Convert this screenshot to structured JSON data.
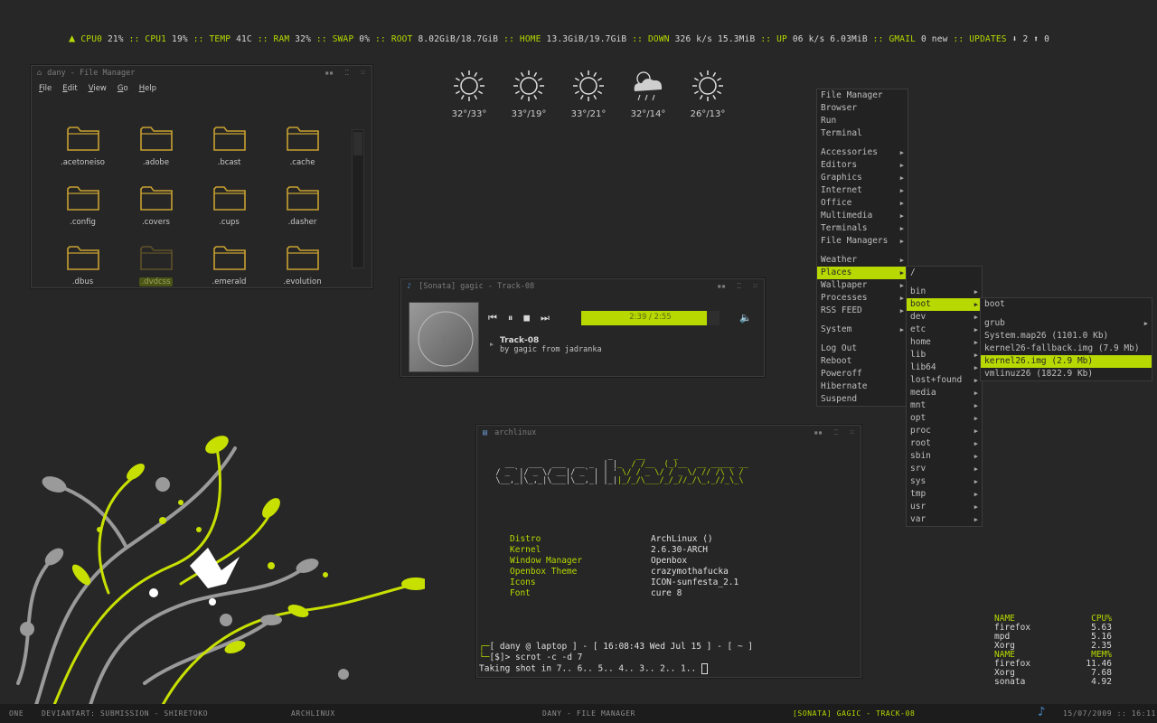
{
  "conky_bar": {
    "logo_icon": "arch-triangle-icon",
    "items": [
      {
        "label": "CPU0",
        "value": "21%"
      },
      {
        "label": "CPU1",
        "value": "19%"
      },
      {
        "label": "TEMP",
        "value": "41C"
      },
      {
        "label": "RAM",
        "value": "32%"
      },
      {
        "label": "SWAP",
        "value": "0%"
      },
      {
        "label": "ROOT",
        "value": "8.02GiB/18.7GiB"
      },
      {
        "label": "HOME",
        "value": "13.3GiB/19.7GiB"
      },
      {
        "label": "DOWN",
        "value": "326  k/s 15.3MiB"
      },
      {
        "label": "UP",
        "value": "06  k/s 6.03MiB"
      },
      {
        "label": "GMAIL",
        "value": "0 new"
      },
      {
        "label": "UPDATES",
        "value": "2",
        "extra": "0"
      }
    ],
    "separator": "::"
  },
  "file_manager": {
    "title": "dany - File Manager",
    "menus": [
      "File",
      "Edit",
      "View",
      "Go",
      "Help"
    ],
    "folders": [
      ".acetoneiso",
      ".adobe",
      ".bcast",
      ".cache",
      ".config",
      ".covers",
      ".cups",
      ".dasher",
      ".dbus",
      ".dvdcss",
      ".emerald",
      ".evolution"
    ],
    "selected_index": 9
  },
  "weather": [
    {
      "icon": "sun-icon",
      "temp": "32°/33°"
    },
    {
      "icon": "sun-icon",
      "temp": "33°/19°"
    },
    {
      "icon": "sun-icon",
      "temp": "33°/21°"
    },
    {
      "icon": "rain-cloud-icon",
      "temp": "32°/14°"
    },
    {
      "icon": "sun-icon",
      "temp": "26°/13°"
    }
  ],
  "sonata": {
    "title": "[Sonata] gagic - Track-08",
    "progress_text": "2:39 / 2:55",
    "progress_fraction": 0.91,
    "track": "Track-08",
    "artist_line": "by gagic from jadranka"
  },
  "terminal": {
    "title": "archlinux",
    "ascii_art": [
      "                          _     __      _",
      "    __   ___  ___  __ _  | |_  / /__  (_)__  __ _____ __",
      "  / _ `|/ _ \\/ __|/ _` | | ' \\/ / _ \\/ / _ \\/ // /\\ \\ /",
      "  \\__,_|\\_,_|\\___|\\__,_| |_||_/_/\\___/_/_//_/\\_,_//_\\_\\"
    ],
    "ascii_green_split": 28,
    "info": [
      {
        "key": "Distro",
        "value": "ArchLinux  ()"
      },
      {
        "key": "Kernel",
        "value": "2.6.30-ARCH"
      },
      {
        "key": "Window Manager",
        "value": "Openbox"
      },
      {
        "key": "Openbox Theme",
        "value": "crazymothafucka"
      },
      {
        "key": "Icons",
        "value": "ICON-sunfesta_2.1"
      },
      {
        "key": "Font",
        "value": "cure 8"
      }
    ],
    "prompt_line1": "[ dany @ laptop ] - [ 16:08:43 Wed Jul 15 ] - [ ~ ]",
    "prompt_line2": "[$]> scrot -c -d 7",
    "output_line": "Taking shot in 7.. 6.. 5.. 4.. 3.. 2.. 1.. "
  },
  "menu_root": {
    "groups": [
      [
        {
          "label": "File Manager"
        },
        {
          "label": "Browser"
        },
        {
          "label": "Run"
        },
        {
          "label": "Terminal"
        }
      ],
      [
        {
          "label": "Accessories",
          "sub": true
        },
        {
          "label": "Editors",
          "sub": true
        },
        {
          "label": "Graphics",
          "sub": true
        },
        {
          "label": "Internet",
          "sub": true
        },
        {
          "label": "Office",
          "sub": true
        },
        {
          "label": "Multimedia",
          "sub": true
        },
        {
          "label": "Terminals",
          "sub": true
        },
        {
          "label": "File Managers",
          "sub": true
        }
      ],
      [
        {
          "label": "Weather",
          "sub": true
        },
        {
          "label": "Places",
          "sub": true,
          "active": true
        },
        {
          "label": "Wallpaper",
          "sub": true
        },
        {
          "label": "Processes",
          "sub": true
        },
        {
          "label": "RSS FEED",
          "sub": true
        }
      ],
      [
        {
          "label": "System",
          "sub": true
        }
      ],
      [
        {
          "label": "Log Out"
        },
        {
          "label": "Reboot"
        },
        {
          "label": "Poweroff"
        },
        {
          "label": "Hibernate"
        },
        {
          "label": "Suspend"
        }
      ]
    ]
  },
  "menu_places": {
    "groups": [
      [
        {
          "label": "/"
        }
      ],
      [
        {
          "label": "bin",
          "sub": true
        },
        {
          "label": "boot",
          "sub": true,
          "active": true
        },
        {
          "label": "dev",
          "sub": true
        },
        {
          "label": "etc",
          "sub": true
        },
        {
          "label": "home",
          "sub": true
        },
        {
          "label": "lib",
          "sub": true
        },
        {
          "label": "lib64",
          "sub": true
        },
        {
          "label": "lost+found",
          "sub": true
        },
        {
          "label": "media",
          "sub": true
        },
        {
          "label": "mnt",
          "sub": true
        },
        {
          "label": "opt",
          "sub": true
        },
        {
          "label": "proc",
          "sub": true
        },
        {
          "label": "root",
          "sub": true
        },
        {
          "label": "sbin",
          "sub": true
        },
        {
          "label": "srv",
          "sub": true
        },
        {
          "label": "sys",
          "sub": true
        },
        {
          "label": "tmp",
          "sub": true
        },
        {
          "label": "usr",
          "sub": true
        },
        {
          "label": "var",
          "sub": true
        }
      ]
    ]
  },
  "menu_boot": {
    "groups": [
      [
        {
          "label": "boot"
        }
      ],
      [
        {
          "label": "grub",
          "sub": true
        },
        {
          "label": "System.map26  (1101.0 Kb)"
        },
        {
          "label": "kernel26-fallback.img  (7.9 Mb)"
        },
        {
          "label": "kernel26.img  (2.9 Mb)",
          "active": true
        },
        {
          "label": "vmlinuz26  (1822.9 Kb)"
        }
      ]
    ]
  },
  "processes": {
    "cpu_header": [
      "NAME",
      "CPU%"
    ],
    "cpu_rows": [
      [
        "firefox",
        "5.63"
      ],
      [
        "mpd",
        "5.16"
      ],
      [
        "Xorg",
        "2.35"
      ]
    ],
    "mem_header": [
      "NAME",
      "MEM%"
    ],
    "mem_rows": [
      [
        "firefox",
        "11.46"
      ],
      [
        "Xorg",
        "7.68"
      ],
      [
        "sonata",
        "4.92"
      ]
    ]
  },
  "taskbar": {
    "desktop": "ONE",
    "tasks": [
      "DEVIANTART: SUBMISSION - SHIRETOKO",
      "ARCHLINUX",
      "DANY - FILE MANAGER",
      "[SONATA] GAGIC - TRACK-08"
    ],
    "active_task_index": 3,
    "tray_icon": "music-note-icon",
    "clock": "15/07/2009 :: 16:11"
  },
  "colors": {
    "accent": "#b7d800",
    "background": "#272727"
  }
}
